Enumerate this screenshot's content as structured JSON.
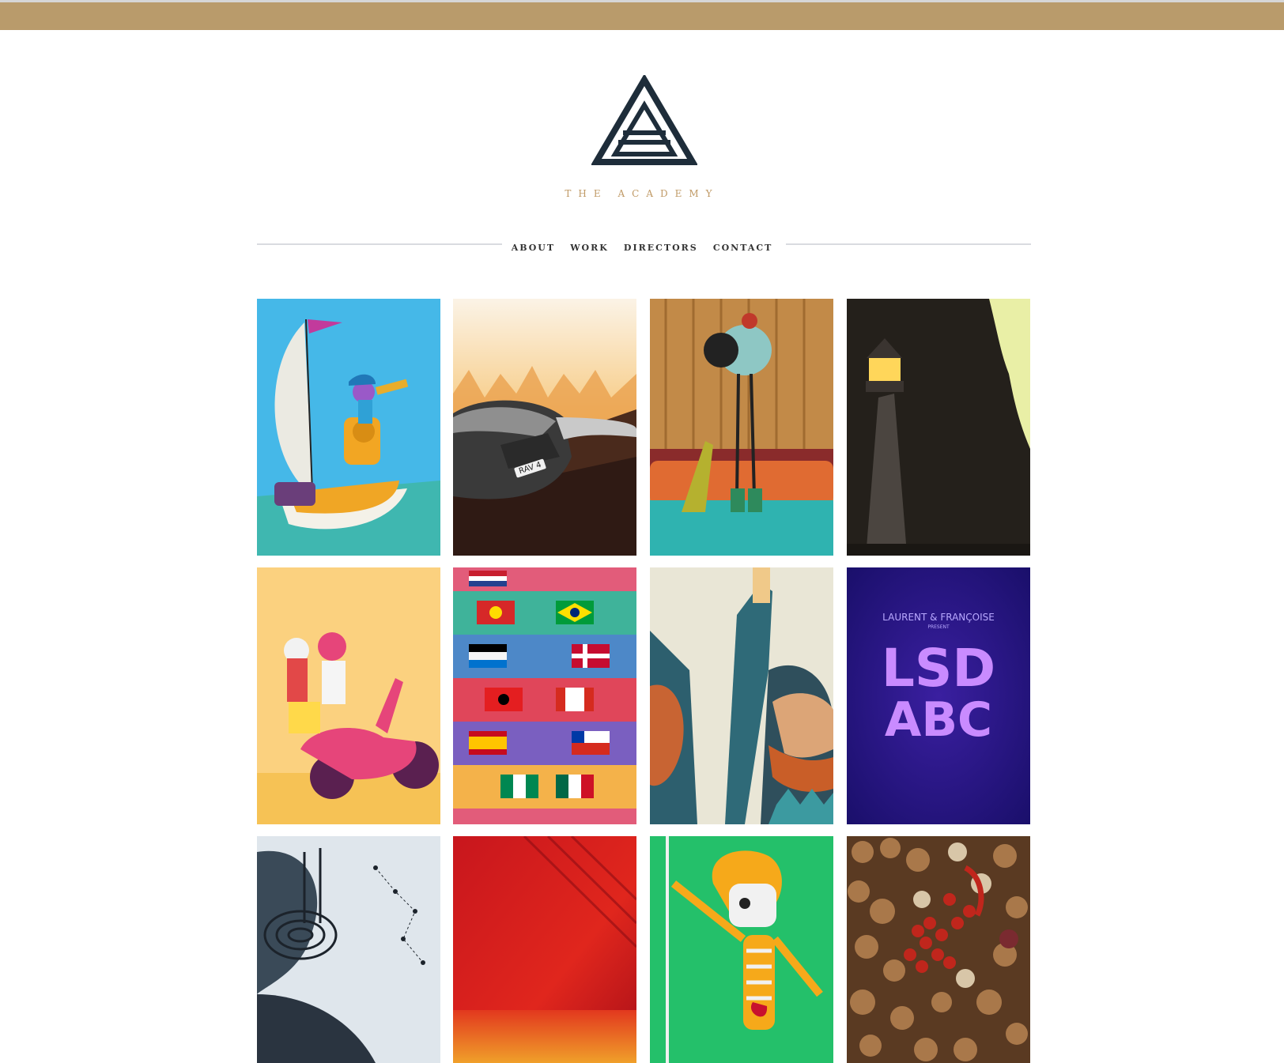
{
  "brand": {
    "name": "THE ACADEMY"
  },
  "nav": {
    "items": [
      "ABOUT",
      "WORK",
      "DIRECTORS",
      "CONTACT"
    ]
  },
  "colors": {
    "accent_bar": "#b99b6b",
    "brand_text": "#c09a66",
    "logo": "#1e2d3a"
  },
  "tiles": {
    "car": {
      "plate": "RAV 4"
    },
    "lsd": {
      "presenter": "LAURENT & FRANÇOISE",
      "present": "PRESENT",
      "line1": "LSD",
      "line2": "ABC"
    }
  }
}
